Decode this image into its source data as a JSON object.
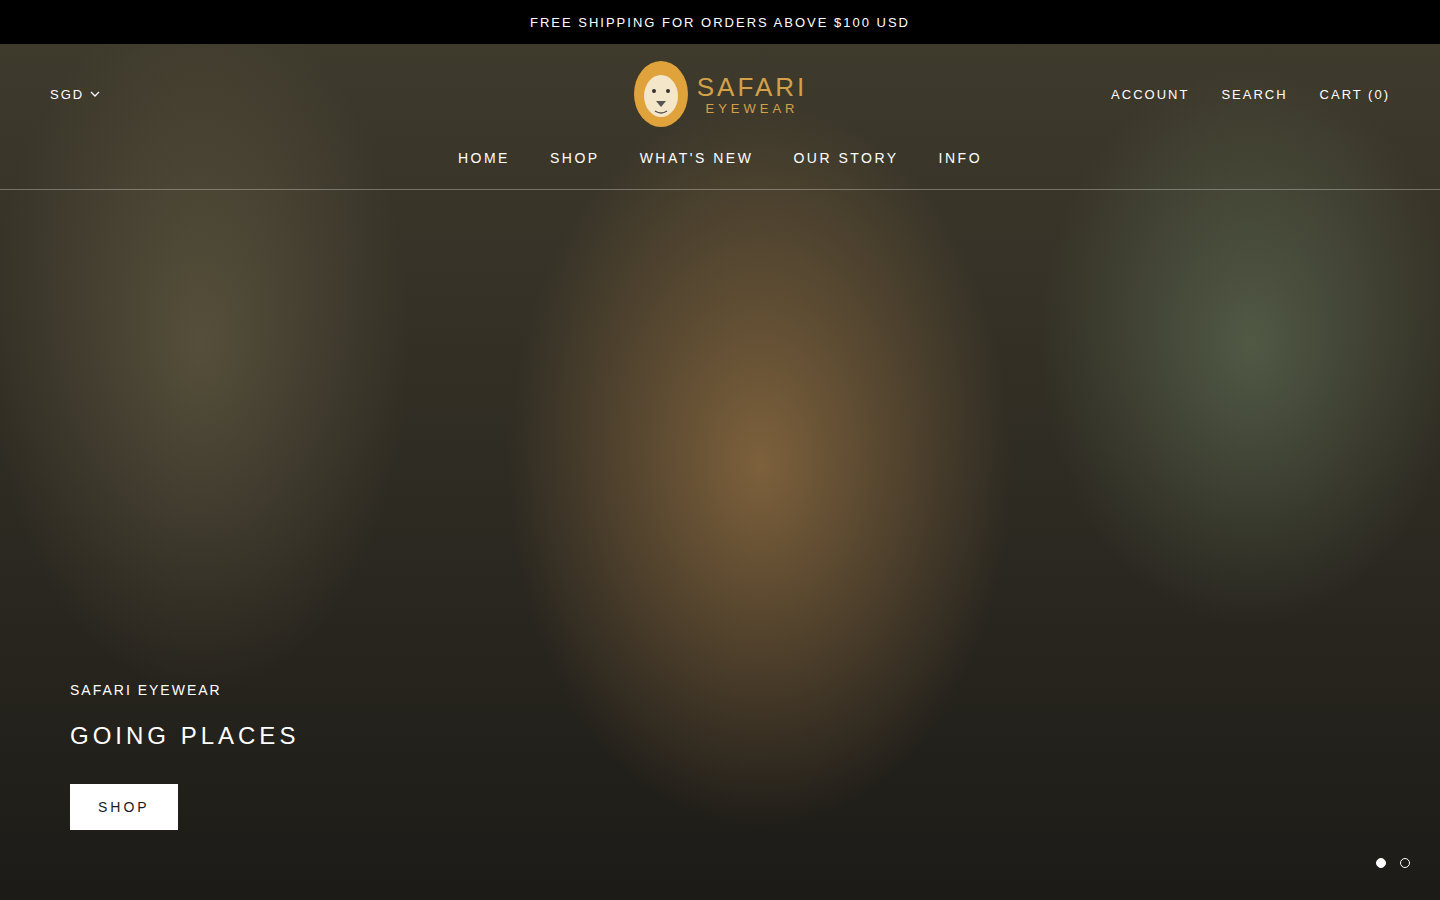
{
  "announcement": "FREE SHIPPING FOR ORDERS ABOVE $100 USD",
  "header": {
    "currency": "SGD",
    "logo": {
      "line1": "SAFARI",
      "line2": "EYEWEAR"
    },
    "links": [
      "ACCOUNT",
      "SEARCH",
      "CART (0)"
    ]
  },
  "nav": [
    "HOME",
    "SHOP",
    "WHAT'S NEW",
    "OUR STORY",
    "INFO"
  ],
  "hero": {
    "subtitle": "SAFARI EYEWEAR",
    "title": "GOING PLACES",
    "button": "SHOP"
  },
  "slides": [
    {
      "selected": true
    },
    {
      "selected": false
    }
  ]
}
